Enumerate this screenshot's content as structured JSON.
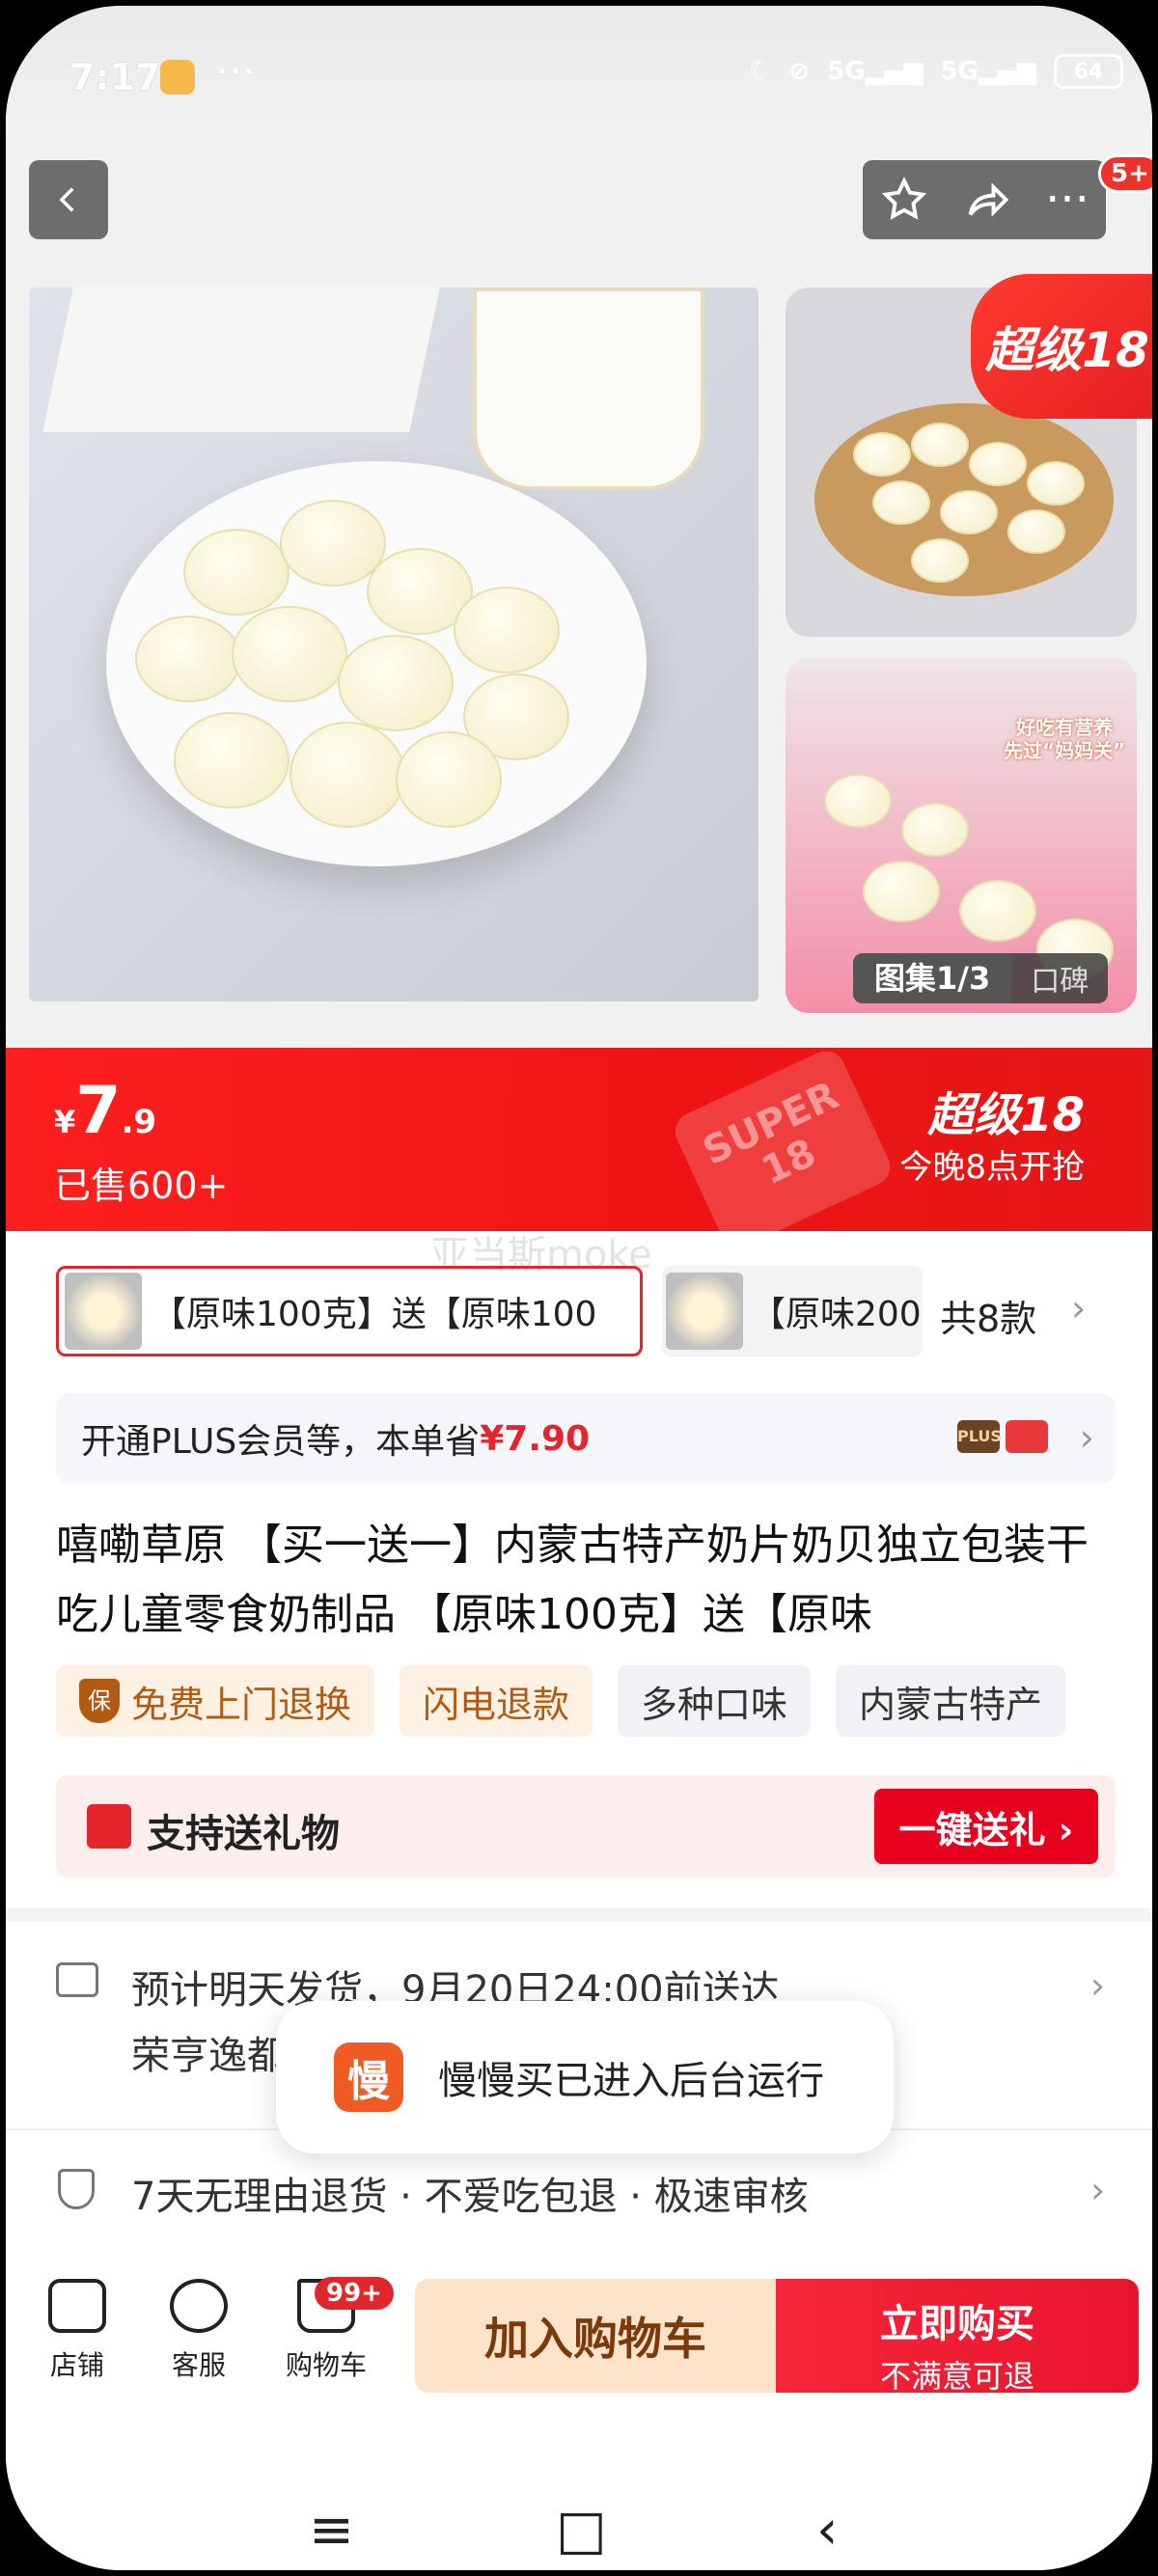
{
  "status_bar": {
    "time": "7:17",
    "dots": "···",
    "battery": "64"
  },
  "nav": {
    "back_icon": "chevron-left-icon",
    "star_icon": "star-icon",
    "share_icon": "share-icon",
    "more": "···",
    "badge": "5+"
  },
  "gallery": {
    "super_tag": "超级18",
    "note_line1": "好吃有营养",
    "note_line2": "先过“妈妈关”",
    "album_label": "图集1/3",
    "review_label": "口碑"
  },
  "price": {
    "currency": "¥",
    "integer": "7",
    "decimal": ".9",
    "sold": "已售600+",
    "stamp_line1": "SUPER",
    "stamp_line2": "18",
    "super_title": "超级18",
    "super_time": "今晚8点开抢"
  },
  "watermark": "亚当斯moke",
  "sku": {
    "option1": "【原味100克】送【原味100",
    "option2": "【原味200",
    "count": "共8款"
  },
  "plus": {
    "prefix": "开通PLUS会员等，本单省",
    "amount": "¥7.90",
    "icon_text": "PLUS"
  },
  "product": {
    "title": "嘻嘞草原 【买一送一】内蒙古特产奶片奶贝独立包装干吃儿童零食奶制品 【原味100克】送【原味"
  },
  "tags": [
    {
      "label": "免费上门退换",
      "icon": "保"
    },
    {
      "label": "闪电退款"
    },
    {
      "label": "多种口味"
    },
    {
      "label": "内蒙古特产"
    }
  ],
  "gift": {
    "label": "支持送礼物",
    "button": "一键送礼 ›"
  },
  "shipping": {
    "line1": "预计明天发货，9月20日24:00前送达",
    "line2": "荣亨逸都"
  },
  "returns": {
    "text": "7天无理由退货 · 不爱吃包退 · 极速审核"
  },
  "toast": {
    "icon": "慢",
    "text": "慢慢买已进入后台运行"
  },
  "bottom": {
    "store": "店铺",
    "service": "客服",
    "cart": "购物车",
    "cart_badge": "99+",
    "add_cart": "加入购物车",
    "buy_now": "立即购买",
    "buy_sub": "不满意可退"
  },
  "system_nav": {
    "menu": "≡",
    "home": "□",
    "back": "‹"
  }
}
